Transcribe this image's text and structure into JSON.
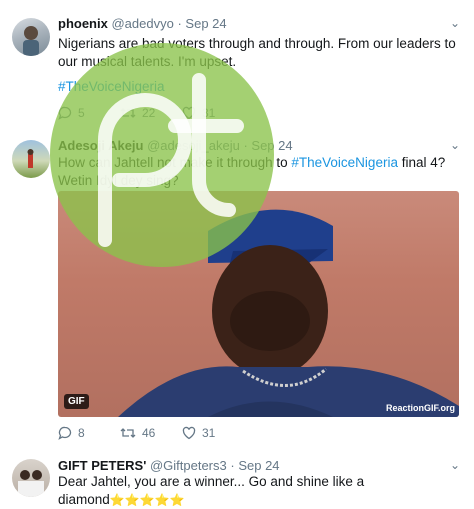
{
  "tweets": [
    {
      "name": "phoenix",
      "handle": "@adedvyo",
      "sep": "·",
      "date": "Sep 24",
      "text": "Nigerians are bad voters through and through. From our leaders to our musical talents. I'm upset.",
      "hashtag": "#TheVoiceNigeria",
      "replies": "5",
      "retweets": "22",
      "likes": "31"
    },
    {
      "name": "Adesoji Akeju",
      "handle": "@adesoji_akeju",
      "sep": "·",
      "date": "Sep 24",
      "text_before": "How can Jahtell not make it through to ",
      "hashtag": "#TheVoiceNigeria",
      "text_after": " final 4? Wetin Idyl dey sing?",
      "gif_badge": "GIF",
      "gif_credit": "ReactionGIF.org",
      "replies": "8",
      "retweets": "46",
      "likes": "31"
    },
    {
      "name": "GIFT PETERS'",
      "handle": "@Giftpeters3",
      "sep": "·",
      "date": "Sep 24",
      "text": "Dear Jahtel, you are a winner... Go and shine like a diamond",
      "emoji": "⭐⭐⭐⭐⭐"
    }
  ],
  "icons": {
    "caret": "chevron-down-icon",
    "reply": "reply-icon",
    "retweet": "retweet-icon",
    "like": "heart-icon"
  },
  "colors": {
    "hashtag": "#1b95e0",
    "watermark": "#8bc34a",
    "muted": "#657786"
  }
}
